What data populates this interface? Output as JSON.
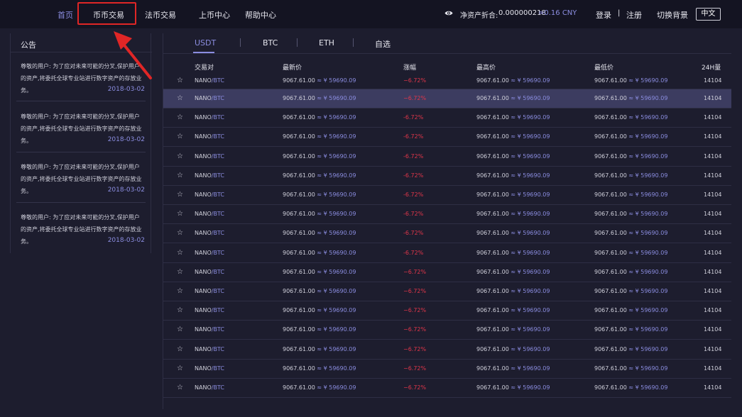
{
  "nav": {
    "items": [
      {
        "label": "首页",
        "active": true
      },
      {
        "label": "币币交易",
        "active": false
      },
      {
        "label": "法币交易",
        "active": false
      },
      {
        "label": "上币中心",
        "active": false
      },
      {
        "label": "帮助中心",
        "active": false
      }
    ],
    "asset_label": "净资产折合:",
    "asset_value": "0.000000218",
    "asset_cny": "≈0.16 CNY",
    "login": "登录",
    "separator": "|",
    "register": "注册",
    "switch_bg": "切换背景",
    "language": "中文"
  },
  "announcement": {
    "title": "公告",
    "items": [
      {
        "text": "尊敬的用户:   为了应对未来可能的分叉,保护用户的资产,将委托全球专业站进行数字资产的存放业务。",
        "date": "2018-03-02"
      },
      {
        "text": "尊敬的用户:   为了应对未来可能的分叉,保护用户的资产,将委托全球专业站进行数字资产的存放业务。",
        "date": "2018-03-02"
      },
      {
        "text": "尊敬的用户:   为了应对未来可能的分叉,保护用户的资产,将委托全球专业站进行数字资产的存放业务。",
        "date": "2018-03-02"
      },
      {
        "text": "尊敬的用户:   为了应对未来可能的分叉,保护用户的资产,将委托全球专业站进行数字资产的存放业务。",
        "date": "2018-03-02"
      }
    ]
  },
  "market": {
    "tabs": [
      "USDT",
      "BTC",
      "ETH",
      "自选"
    ],
    "active_tab": "USDT",
    "headers": {
      "pair": "交易对",
      "latest": "最新价",
      "change": "涨幅",
      "high": "最高价",
      "low": "最低价",
      "volume": "24H量"
    },
    "selected_row": 1,
    "rows": [
      {
        "base": "NANO",
        "quote": "/BTC",
        "latest": "9067.61.00",
        "latest_cny": "≈ ¥ 59690.09",
        "change": "−6.72%",
        "high": "9067.61.00",
        "high_cny": "≈ ¥ 59690.09",
        "low": "9067.61.00",
        "low_cny": "≈ ¥ 59690.09",
        "volume": "14104"
      },
      {
        "base": "NANO",
        "quote": "/BTC",
        "latest": "9067.61.00",
        "latest_cny": "≈ ¥ 59690.09",
        "change": "−6.72%",
        "high": "9067.61.00",
        "high_cny": "≈ ¥ 59690.09",
        "low": "9067.61.00",
        "low_cny": "≈ ¥ 59690.09",
        "volume": "14104"
      },
      {
        "base": "NANO",
        "quote": "/BTC",
        "latest": "9067.61.00",
        "latest_cny": "≈ ¥ 59690.09",
        "change": "-6.72%",
        "high": "9067.61.00",
        "high_cny": "≈ ¥ 59690.09",
        "low": "9067.61.00",
        "low_cny": "≈ ¥ 59690.09",
        "volume": "14104"
      },
      {
        "base": "NANO",
        "quote": "/BTC",
        "latest": "9067.61.00",
        "latest_cny": "≈ ¥ 59690.09",
        "change": "-6.72%",
        "high": "9067.61.00",
        "high_cny": "≈ ¥ 59690.09",
        "low": "9067.61.00",
        "low_cny": "≈ ¥ 59690.09",
        "volume": "14104"
      },
      {
        "base": "NANO",
        "quote": "/BTC",
        "latest": "9067.61.00",
        "latest_cny": "≈ ¥ 59690.09",
        "change": "-6.72%",
        "high": "9067.61.00",
        "high_cny": "≈ ¥ 59690.09",
        "low": "9067.61.00",
        "low_cny": "≈ ¥ 59690.09",
        "volume": "14104"
      },
      {
        "base": "NANO",
        "quote": "/BTC",
        "latest": "9067.61.00",
        "latest_cny": "≈ ¥ 59690.09",
        "change": "-6.72%",
        "high": "9067.61.00",
        "high_cny": "≈ ¥ 59690.09",
        "low": "9067.61.00",
        "low_cny": "≈ ¥ 59690.09",
        "volume": "14104"
      },
      {
        "base": "NANO",
        "quote": "/BTC",
        "latest": "9067.61.00",
        "latest_cny": "≈ ¥ 59690.09",
        "change": "-6.72%",
        "high": "9067.61.00",
        "high_cny": "≈ ¥ 59690.09",
        "low": "9067.61.00",
        "low_cny": "≈ ¥ 59690.09",
        "volume": "14104"
      },
      {
        "base": "NANO",
        "quote": "/BTC",
        "latest": "9067.61.00",
        "latest_cny": "≈ ¥ 59690.09",
        "change": "-6.72%",
        "high": "9067.61.00",
        "high_cny": "≈ ¥ 59690.09",
        "low": "9067.61.00",
        "low_cny": "≈ ¥ 59690.09",
        "volume": "14104"
      },
      {
        "base": "NANO",
        "quote": "/BTC",
        "latest": "9067.61.00",
        "latest_cny": "≈ ¥ 59690.09",
        "change": "-6.72%",
        "high": "9067.61.00",
        "high_cny": "≈ ¥ 59690.09",
        "low": "9067.61.00",
        "low_cny": "≈ ¥ 59690.09",
        "volume": "14104"
      },
      {
        "base": "NANO",
        "quote": "/BTC",
        "latest": "9067.61.00",
        "latest_cny": "≈ ¥ 59690.09",
        "change": "-6.72%",
        "high": "9067.61.00",
        "high_cny": "≈ ¥ 59690.09",
        "low": "9067.61.00",
        "low_cny": "≈ ¥ 59690.09",
        "volume": "14104"
      },
      {
        "base": "NANO",
        "quote": "/BTC",
        "latest": "9067.61.00",
        "latest_cny": "≈ ¥ 59690.09",
        "change": "−6.72%",
        "high": "9067.61.00",
        "high_cny": "≈ ¥ 59690.09",
        "low": "9067.61.00",
        "low_cny": "≈ ¥ 59690.09",
        "volume": "14104"
      },
      {
        "base": "NANO",
        "quote": "/BTC",
        "latest": "9067.61.00",
        "latest_cny": "≈ ¥ 59690.09",
        "change": "−6.72%",
        "high": "9067.61.00",
        "high_cny": "≈ ¥ 59690.09",
        "low": "9067.61.00",
        "low_cny": "≈ ¥ 59690.09",
        "volume": "14104"
      },
      {
        "base": "NANO",
        "quote": "/BTC",
        "latest": "9067.61.00",
        "latest_cny": "≈ ¥ 59690.09",
        "change": "−6.72%",
        "high": "9067.61.00",
        "high_cny": "≈ ¥ 59690.09",
        "low": "9067.61.00",
        "low_cny": "≈ ¥ 59690.09",
        "volume": "14104"
      },
      {
        "base": "NANO",
        "quote": "/BTC",
        "latest": "9067.61.00",
        "latest_cny": "≈ ¥ 59690.09",
        "change": "−6.72%",
        "high": "9067.61.00",
        "high_cny": "≈ ¥ 59690.09",
        "low": "9067.61.00",
        "low_cny": "≈ ¥ 59690.09",
        "volume": "14104"
      },
      {
        "base": "NANO",
        "quote": "/BTC",
        "latest": "9067.61.00",
        "latest_cny": "≈ ¥ 59690.09",
        "change": "−6.72%",
        "high": "9067.61.00",
        "high_cny": "≈ ¥ 59690.09",
        "low": "9067.61.00",
        "low_cny": "≈ ¥ 59690.09",
        "volume": "14104"
      },
      {
        "base": "NANO",
        "quote": "/BTC",
        "latest": "9067.61.00",
        "latest_cny": "≈ ¥ 59690.09",
        "change": "−6.72%",
        "high": "9067.61.00",
        "high_cny": "≈ ¥ 59690.09",
        "low": "9067.61.00",
        "low_cny": "≈ ¥ 59690.09",
        "volume": "14104"
      },
      {
        "base": "NANO",
        "quote": "/BTC",
        "latest": "9067.61.00",
        "latest_cny": "≈ ¥ 59690.09",
        "change": "−6.72%",
        "high": "9067.61.00",
        "high_cny": "≈ ¥ 59690.09",
        "low": "9067.61.00",
        "low_cny": "≈ ¥ 59690.09",
        "volume": "14104"
      }
    ]
  },
  "colors": {
    "accent": "#8b8de0",
    "negative": "#e0364a",
    "highlight_box": "#e02626",
    "background": "#1d1d2e",
    "navbar": "#141422",
    "selected_row": "#3c3c60"
  },
  "icons": [
    "eye-icon",
    "star-icon",
    "red-arrow-annotation"
  ]
}
